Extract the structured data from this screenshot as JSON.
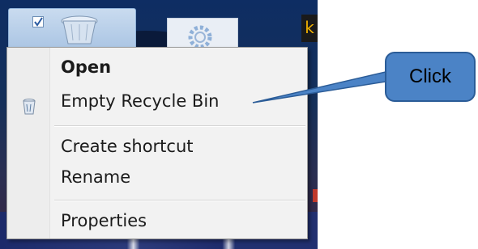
{
  "desktop": {
    "badge_text": "k"
  },
  "context_menu": {
    "items": [
      {
        "label": "Open",
        "bold": true
      },
      {
        "label": "Empty Recycle Bin",
        "icon": "recycle-bin-icon"
      },
      {
        "label": "Create shortcut"
      },
      {
        "label": "Rename"
      },
      {
        "label": "Properties"
      }
    ]
  },
  "callout": {
    "label": "Click",
    "fill_color": "#4b83c6",
    "border_color": "#2b5c97"
  }
}
